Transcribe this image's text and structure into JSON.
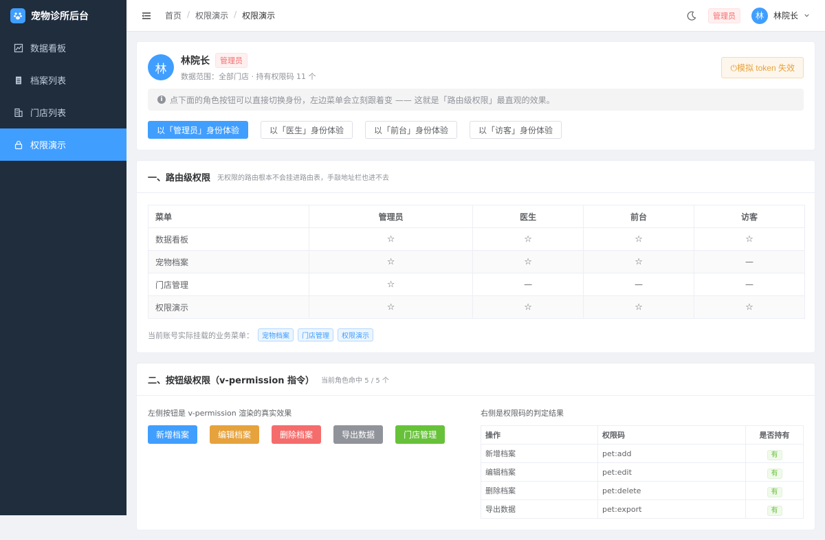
{
  "brand": {
    "name": "宠物诊所后台"
  },
  "sidebar": {
    "items": [
      {
        "label": "数据看板",
        "icon": "chart-icon"
      },
      {
        "label": "档案列表",
        "icon": "file-icon"
      },
      {
        "label": "门店列表",
        "icon": "building-icon"
      },
      {
        "label": "权限演示",
        "icon": "lock-icon",
        "active": true
      }
    ]
  },
  "header": {
    "breadcrumb": [
      "首页",
      "权限演示",
      "权限演示"
    ],
    "role_tag": "管理员",
    "user_avatar": "林",
    "user_name": "林院长"
  },
  "profile": {
    "avatar": "林",
    "name": "林院长",
    "role_tag": "管理员",
    "scope": "数据范围：全部门店 · 持有权限码 11 个",
    "token_button": "模拟 token 失效",
    "tip": "点下面的角色按钮可以直接切换身份，左边菜单会立刻跟着变 —— 这就是「路由级权限」最直观的效果。",
    "role_buttons": [
      "以「管理员」身份体验",
      "以「医生」身份体验",
      "以「前台」身份体验",
      "以「访客」身份体验"
    ]
  },
  "route_section": {
    "title": "一、路由级权限",
    "desc": "无权限的路由根本不会挂进路由表，手敲地址栏也进不去",
    "columns": [
      "菜单",
      "管理员",
      "医生",
      "前台",
      "访客"
    ],
    "rows": [
      {
        "menu": "数据看板",
        "cells": [
          "☆",
          "☆",
          "☆",
          "☆"
        ]
      },
      {
        "menu": "宠物档案",
        "cells": [
          "☆",
          "☆",
          "☆",
          "—"
        ]
      },
      {
        "menu": "门店管理",
        "cells": [
          "☆",
          "—",
          "—",
          "—"
        ]
      },
      {
        "menu": "权限演示",
        "cells": [
          "☆",
          "☆",
          "☆",
          "☆"
        ]
      }
    ],
    "mounted_label": "当前账号实际挂载的业务菜单：",
    "mounted": [
      "宠物档案",
      "门店管理",
      "权限演示"
    ]
  },
  "button_section": {
    "title": "二、按钮级权限（v-permission 指令）",
    "desc": "当前角色命中 5 / 5 个",
    "left_label": "左侧按钮是 v-permission 渲染的真实效果",
    "right_label": "右侧是权限码的判定结果",
    "buttons": [
      {
        "label": "新增档案",
        "color": "#409eff"
      },
      {
        "label": "编辑档案",
        "color": "#e6a23c"
      },
      {
        "label": "删除档案",
        "color": "#f56c6c"
      },
      {
        "label": "导出数据",
        "color": "#909399"
      },
      {
        "label": "门店管理",
        "color": "#67c23a"
      }
    ],
    "table_headers": [
      "操作",
      "权限码",
      "是否持有"
    ],
    "table_rows": [
      {
        "op": "新增档案",
        "code": "pet:add",
        "has": "有"
      },
      {
        "op": "编辑档案",
        "code": "pet:edit",
        "has": "有"
      },
      {
        "op": "删除档案",
        "code": "pet:delete",
        "has": "有"
      },
      {
        "op": "导出数据",
        "code": "pet:export",
        "has": "有"
      }
    ]
  }
}
